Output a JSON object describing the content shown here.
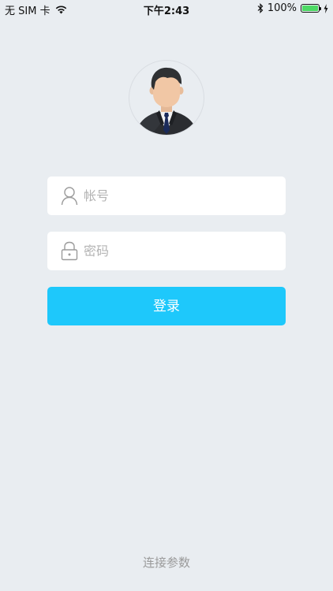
{
  "status_bar": {
    "carrier": "无 SIM 卡",
    "time": "下午2:43",
    "battery_percent": "100%",
    "battery_level": 1.0
  },
  "login": {
    "account_placeholder": "帐号",
    "password_placeholder": "密码",
    "submit_label": "登录"
  },
  "footer": {
    "connection_params_label": "连接参数"
  },
  "colors": {
    "background": "#e9edf1",
    "primary_button": "#1ec8fb",
    "battery_fill": "#4cd964"
  }
}
